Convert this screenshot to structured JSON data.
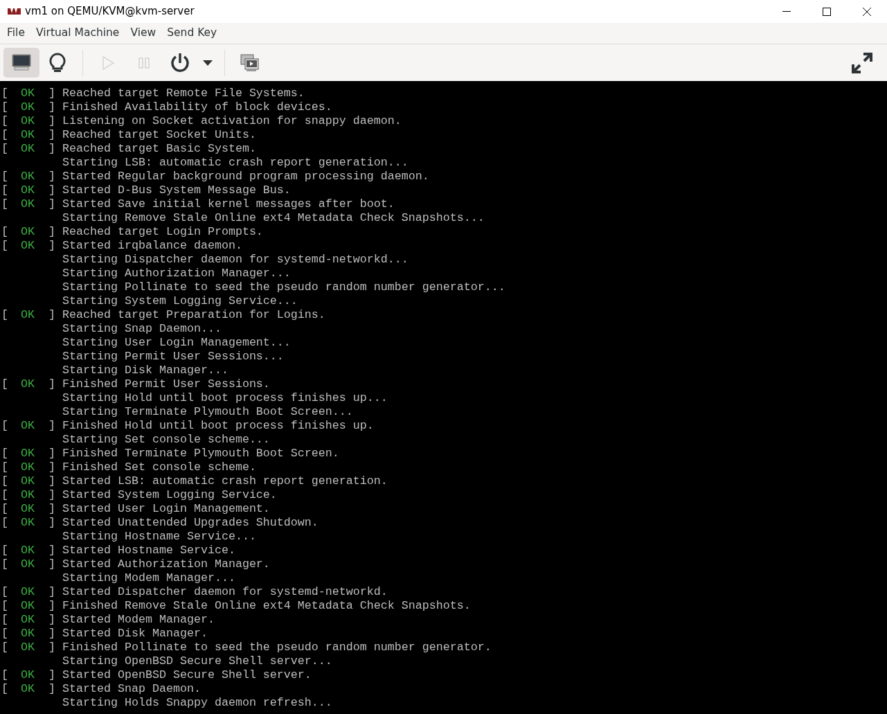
{
  "window": {
    "title": "vm1 on QEMU/KVM@kvm-server"
  },
  "menu": [
    "File",
    "Virtual Machine",
    "View",
    "Send Key"
  ],
  "toolbar": [
    {
      "kind": "console",
      "selected": true,
      "disabled": false
    },
    {
      "kind": "details",
      "selected": false,
      "disabled": false
    },
    {
      "kind": "separator"
    },
    {
      "kind": "run",
      "selected": false,
      "disabled": true
    },
    {
      "kind": "pause",
      "selected": false,
      "disabled": true
    },
    {
      "kind": "power",
      "selected": false,
      "disabled": false
    },
    {
      "kind": "dropdown",
      "selected": false,
      "disabled": false
    },
    {
      "kind": "separator"
    },
    {
      "kind": "snapshots",
      "selected": false,
      "disabled": false
    },
    {
      "kind": "fullscreen",
      "selected": false,
      "disabled": false
    }
  ],
  "console": [
    {
      "kind": "ok",
      "left": "[",
      "status": "OK",
      "right": "]",
      "message": "Reached target Remote File Systems."
    },
    {
      "kind": "ok",
      "left": "[",
      "status": "OK",
      "right": "]",
      "message": "Finished Availability of block devices."
    },
    {
      "kind": "ok",
      "left": "[",
      "status": "OK",
      "right": "]",
      "message": "Listening on Socket activation for snappy daemon."
    },
    {
      "kind": "ok",
      "left": "[",
      "status": "OK",
      "right": "]",
      "message": "Reached target Socket Units."
    },
    {
      "kind": "ok",
      "left": "[",
      "status": "OK",
      "right": "]",
      "message": "Reached target Basic System."
    },
    {
      "kind": "job",
      "message": "Starting LSB: automatic crash report generation..."
    },
    {
      "kind": "ok",
      "left": "[",
      "status": "OK",
      "right": "]",
      "message": "Started Regular background program processing daemon."
    },
    {
      "kind": "ok",
      "left": "[",
      "status": "OK",
      "right": "]",
      "message": "Started D-Bus System Message Bus."
    },
    {
      "kind": "ok",
      "left": "[",
      "status": "OK",
      "right": "]",
      "message": "Started Save initial kernel messages after boot."
    },
    {
      "kind": "job",
      "message": "Starting Remove Stale Online ext4 Metadata Check Snapshots..."
    },
    {
      "kind": "ok",
      "left": "[",
      "status": "OK",
      "right": "]",
      "message": "Reached target Login Prompts."
    },
    {
      "kind": "ok",
      "left": "[",
      "status": "OK",
      "right": "]",
      "message": "Started irqbalance daemon."
    },
    {
      "kind": "job",
      "message": "Starting Dispatcher daemon for systemd-networkd..."
    },
    {
      "kind": "job",
      "message": "Starting Authorization Manager..."
    },
    {
      "kind": "job",
      "message": "Starting Pollinate to seed the pseudo random number generator..."
    },
    {
      "kind": "job",
      "message": "Starting System Logging Service..."
    },
    {
      "kind": "ok",
      "left": "[",
      "status": "OK",
      "right": "]",
      "message": "Reached target Preparation for Logins."
    },
    {
      "kind": "job",
      "message": "Starting Snap Daemon..."
    },
    {
      "kind": "job",
      "message": "Starting User Login Management..."
    },
    {
      "kind": "job",
      "message": "Starting Permit User Sessions..."
    },
    {
      "kind": "job",
      "message": "Starting Disk Manager..."
    },
    {
      "kind": "ok",
      "left": "[",
      "status": "OK",
      "right": "]",
      "message": "Finished Permit User Sessions."
    },
    {
      "kind": "job",
      "message": "Starting Hold until boot process finishes up..."
    },
    {
      "kind": "job",
      "message": "Starting Terminate Plymouth Boot Screen..."
    },
    {
      "kind": "ok",
      "left": "[",
      "status": "OK",
      "right": "]",
      "message": "Finished Hold until boot process finishes up."
    },
    {
      "kind": "job",
      "message": "Starting Set console scheme..."
    },
    {
      "kind": "ok",
      "left": "[",
      "status": "OK",
      "right": "]",
      "message": "Finished Terminate Plymouth Boot Screen."
    },
    {
      "kind": "ok",
      "left": "[",
      "status": "OK",
      "right": "]",
      "message": "Finished Set console scheme."
    },
    {
      "kind": "ok",
      "left": "[",
      "status": "OK",
      "right": "]",
      "message": "Started LSB: automatic crash report generation."
    },
    {
      "kind": "ok",
      "left": "[",
      "status": "OK",
      "right": "]",
      "message": "Started System Logging Service."
    },
    {
      "kind": "ok",
      "left": "[",
      "status": "OK",
      "right": "]",
      "message": "Started User Login Management."
    },
    {
      "kind": "ok",
      "left": "[",
      "status": "OK",
      "right": "]",
      "message": "Started Unattended Upgrades Shutdown."
    },
    {
      "kind": "job",
      "message": "Starting Hostname Service..."
    },
    {
      "kind": "ok",
      "left": "[",
      "status": "OK",
      "right": "]",
      "message": "Started Hostname Service."
    },
    {
      "kind": "ok",
      "left": "[",
      "status": "OK",
      "right": "]",
      "message": "Started Authorization Manager."
    },
    {
      "kind": "job",
      "message": "Starting Modem Manager..."
    },
    {
      "kind": "ok",
      "left": "[",
      "status": "OK",
      "right": "]",
      "message": "Started Dispatcher daemon for systemd-networkd."
    },
    {
      "kind": "ok",
      "left": "[",
      "status": "OK",
      "right": "]",
      "message": "Finished Remove Stale Online ext4 Metadata Check Snapshots."
    },
    {
      "kind": "ok",
      "left": "[",
      "status": "OK",
      "right": "]",
      "message": "Started Modem Manager."
    },
    {
      "kind": "ok",
      "left": "[",
      "status": "OK",
      "right": "]",
      "message": "Started Disk Manager."
    },
    {
      "kind": "ok",
      "left": "[",
      "status": "OK",
      "right": "]",
      "message": "Finished Pollinate to seed the pseudo random number generator."
    },
    {
      "kind": "job",
      "message": "Starting OpenBSD Secure Shell server..."
    },
    {
      "kind": "ok",
      "left": "[",
      "status": "OK",
      "right": "]",
      "message": "Started OpenBSD Secure Shell server."
    },
    {
      "kind": "ok",
      "left": "[",
      "status": "OK",
      "right": "]",
      "message": "Started Snap Daemon."
    },
    {
      "kind": "job",
      "message": "Starting Holds Snappy daemon refresh..."
    }
  ]
}
